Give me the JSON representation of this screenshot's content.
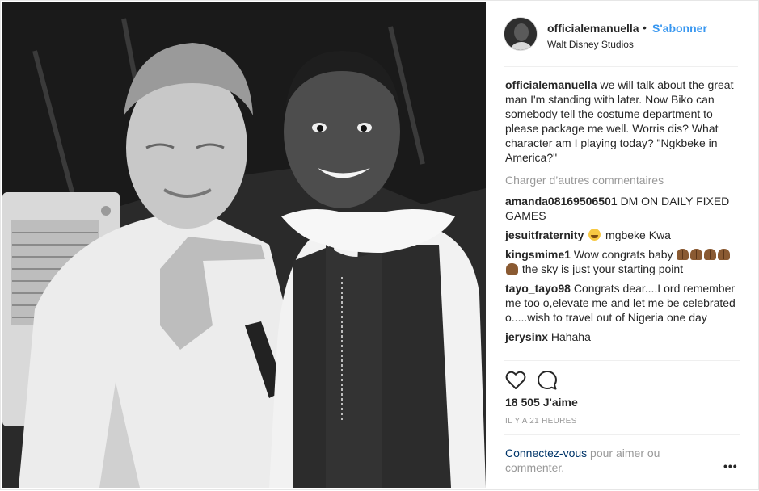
{
  "post": {
    "username": "officialemanuella",
    "dot": "•",
    "follow_label": "S'abonner",
    "location": "Walt Disney Studios"
  },
  "caption": {
    "username": "officialemanuella",
    "text": "we will talk about the great man I'm standing with later. Now Biko can somebody tell the costume department to please package me well. Worris dis? What character am I playing today? \"Ngkbeke in America?\""
  },
  "load_more_label": "Charger d’autres commentaires",
  "comments": [
    {
      "username": "amanda08169506501",
      "text": "DM ON DAILY FIXED GAMES"
    },
    {
      "username": "jesuitfraternity",
      "emoji": "face-with-tears-of-joy",
      "text": "mgbeke Kwa"
    },
    {
      "username": "kingsmime1",
      "text_before": "Wow congrats baby",
      "emoji": "folded-hands",
      "text_after": "the sky is just your starting point"
    },
    {
      "username": "tayo_tayo98",
      "text": "Congrats dear....Lord remember me too o,elevate me and let me be celebrated o.....wish to travel out of Nigeria one day"
    },
    {
      "username": "jerysinx",
      "text": "Hahaha"
    }
  ],
  "actions": {
    "like_icon": "heart-outline-icon",
    "comment_icon": "speech-bubble-icon"
  },
  "likes_label": "18 505 J'aime",
  "timestamp": "IL Y A 21 HEURES",
  "footer": {
    "login_link": "Connectez-vous",
    "login_text": " pour aimer ou commenter.",
    "more_label": "•••"
  },
  "colors": {
    "link": "#3897f0",
    "muted": "#999999",
    "text": "#262626",
    "border": "#efefef"
  }
}
